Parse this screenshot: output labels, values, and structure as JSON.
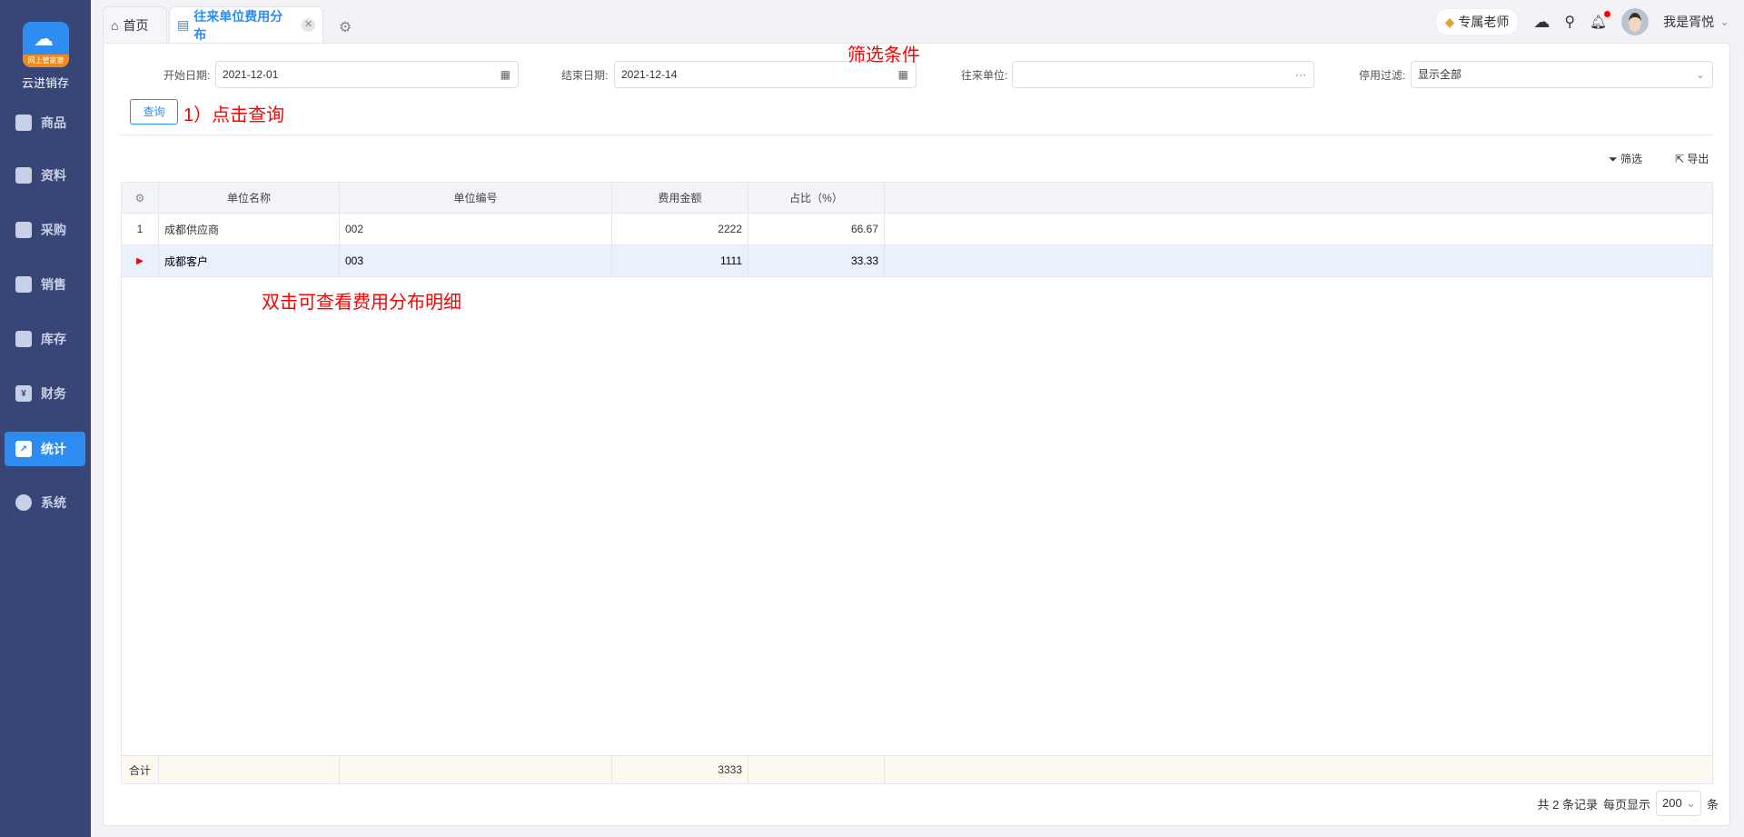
{
  "app": {
    "brand": "云进销存",
    "logo_text": "网上管家婆"
  },
  "sidebar": {
    "items": [
      {
        "label": "商品",
        "icon": "bag-icon"
      },
      {
        "label": "资料",
        "icon": "document-icon"
      },
      {
        "label": "采购",
        "icon": "cart-icon"
      },
      {
        "label": "销售",
        "icon": "bar-chart-icon"
      },
      {
        "label": "库存",
        "icon": "warehouse-icon"
      },
      {
        "label": "财务",
        "icon": "yuan-icon"
      },
      {
        "label": "统计",
        "icon": "trend-icon",
        "active": true
      },
      {
        "label": "系统",
        "icon": "hexagon-icon"
      }
    ]
  },
  "tabs": [
    {
      "label": "首页"
    },
    {
      "label": "往来单位费用分布",
      "active": true
    }
  ],
  "header": {
    "teacher": "专属老师",
    "user": "我是胥悦"
  },
  "filters": {
    "start_label": "开始日期:",
    "start_value": "2021-12-01",
    "end_label": "结束日期:",
    "end_value": "2021-12-14",
    "unit_label": "往来单位:",
    "unit_value": "",
    "disable_label": "停用过滤:",
    "disable_value": "显示全部",
    "query": "查询"
  },
  "annotations": {
    "filter": "筛选条件",
    "query": "1）点击查询",
    "dblclick": "双击可查看费用分布明细"
  },
  "toolbar": {
    "filter": "筛选",
    "export": "导出"
  },
  "table": {
    "columns": [
      "单位名称",
      "单位编号",
      "费用金额",
      "占比（%）"
    ],
    "rows": [
      {
        "idx": "1",
        "name": "成都供应商",
        "code": "002",
        "amount": "2222",
        "ratio": "66.67"
      },
      {
        "idx": "",
        "name": "成都客户",
        "code": "003",
        "amount": "1111",
        "ratio": "33.33",
        "selected": true
      }
    ],
    "footer": {
      "label": "合计",
      "amount": "3333"
    }
  },
  "pager": {
    "total": "共 2 条记录",
    "per_page_label": "每页显示",
    "per_page": "200",
    "unit": "条"
  },
  "colors": {
    "sidebar": "#384677",
    "accent": "#2d8cf0",
    "annotation": "#ff0000"
  }
}
